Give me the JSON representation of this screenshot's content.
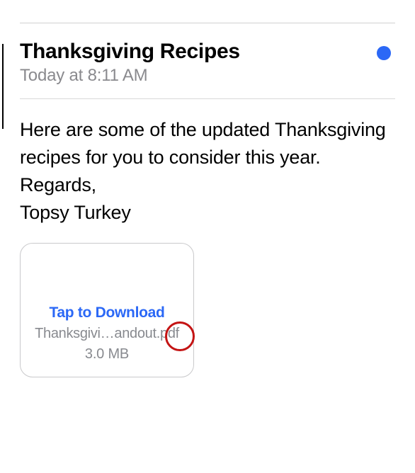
{
  "email": {
    "subject": "Thanksgiving Recipes",
    "timestamp": "Today at 8:11 AM",
    "body_line1": "Here are some of the updated Thanksgiving recipes for you to consider this year.",
    "body_line2": "Regards,",
    "body_line3": "Topsy Turkey"
  },
  "attachment": {
    "action_label": "Tap to Download",
    "filename": "Thanksgivi…andout.pdf",
    "size": "3.0 MB"
  }
}
